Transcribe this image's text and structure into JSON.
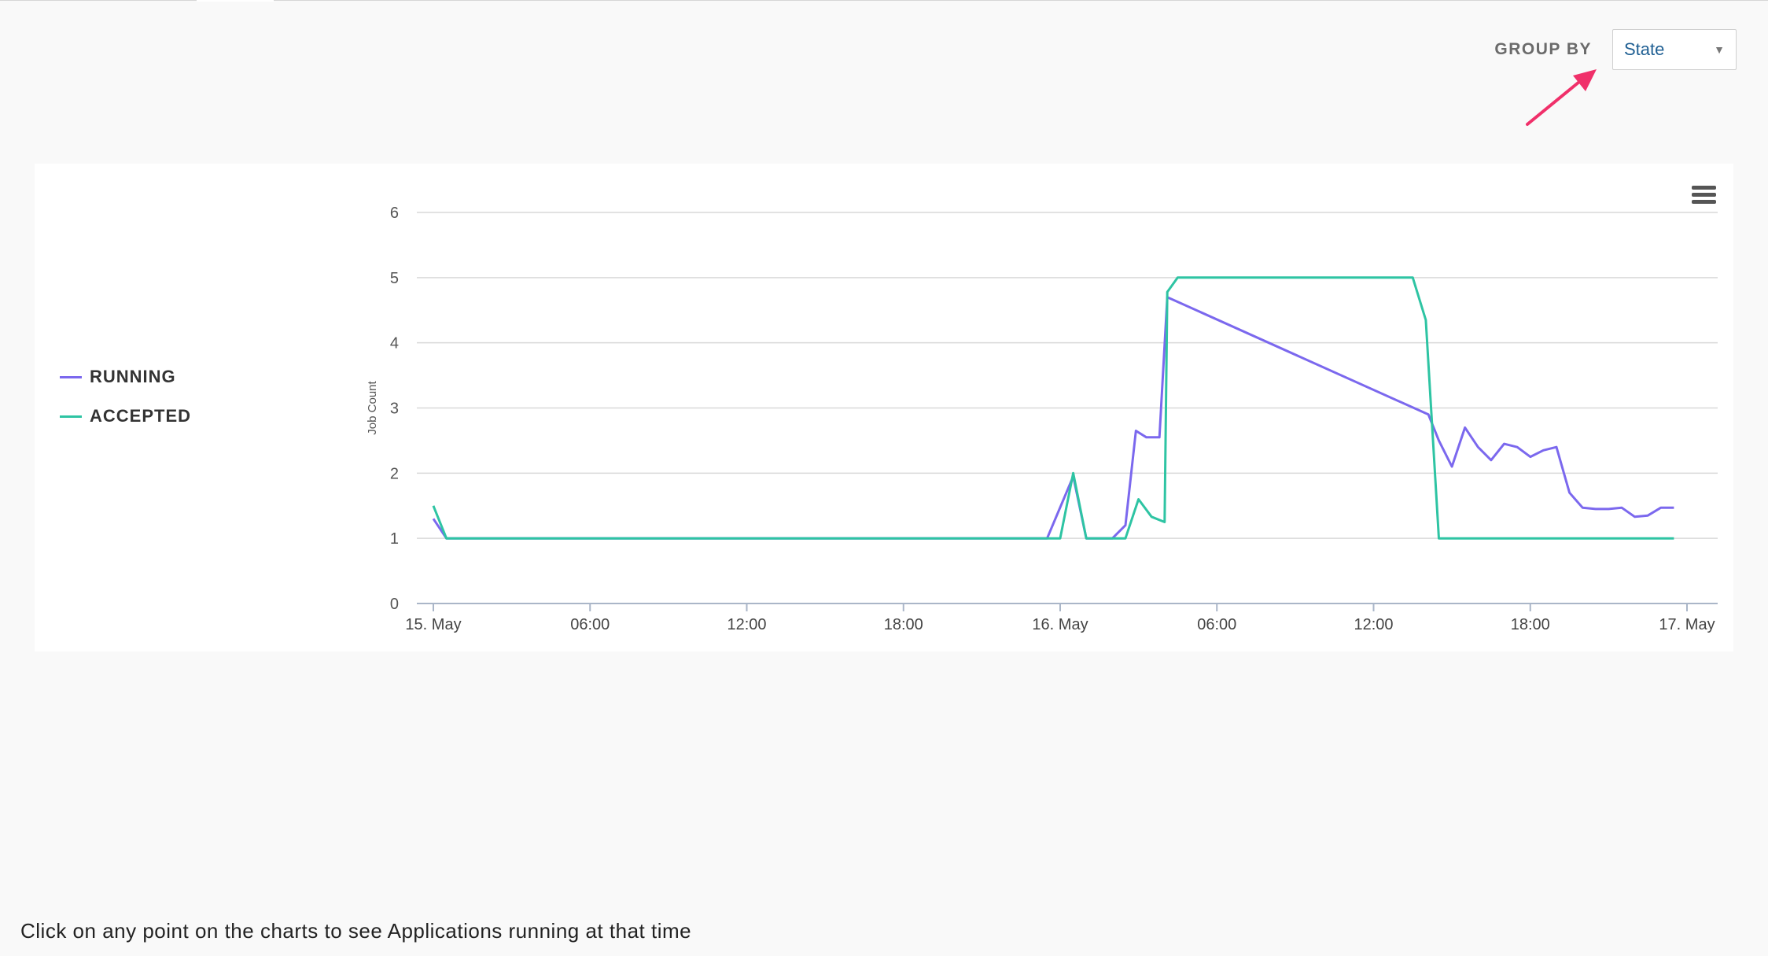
{
  "header": {
    "group_by_label": "GROUP BY",
    "group_by_value": "State"
  },
  "footer": {
    "hint": "Click on any point on the charts to see Applications running at that time"
  },
  "chart_data": {
    "type": "line",
    "ylabel": "Job Count",
    "ylim": [
      0,
      6
    ],
    "yticks": [
      0,
      1,
      2,
      3,
      4,
      5,
      6
    ],
    "xlim_hours": [
      0,
      48
    ],
    "xticks": [
      {
        "t": 0,
        "label": "15. May"
      },
      {
        "t": 6,
        "label": "06:00"
      },
      {
        "t": 12,
        "label": "12:00"
      },
      {
        "t": 18,
        "label": "18:00"
      },
      {
        "t": 24,
        "label": "16. May"
      },
      {
        "t": 30,
        "label": "06:00"
      },
      {
        "t": 36,
        "label": "12:00"
      },
      {
        "t": 42,
        "label": "18:00"
      },
      {
        "t": 48,
        "label": "17. May"
      }
    ],
    "grid": true,
    "legend_position": "left",
    "series": [
      {
        "name": "RUNNING",
        "color": "#7b68ee",
        "points": [
          [
            0,
            1.3
          ],
          [
            0.5,
            1
          ],
          [
            23.5,
            1
          ],
          [
            24.5,
            1.95
          ],
          [
            25,
            1
          ],
          [
            26,
            1
          ],
          [
            26.5,
            1.2
          ],
          [
            26.9,
            2.65
          ],
          [
            27.3,
            2.55
          ],
          [
            27.8,
            2.55
          ],
          [
            28.1,
            4.7
          ],
          [
            38.1,
            2.9
          ],
          [
            38.5,
            2.5
          ],
          [
            39,
            2.1
          ],
          [
            39.5,
            2.7
          ],
          [
            40,
            2.4
          ],
          [
            40.5,
            2.2
          ],
          [
            41,
            2.45
          ],
          [
            41.5,
            2.4
          ],
          [
            42,
            2.25
          ],
          [
            42.5,
            2.35
          ],
          [
            43,
            2.4
          ],
          [
            43.5,
            1.7
          ],
          [
            44,
            1.47
          ],
          [
            44.5,
            1.45
          ],
          [
            45,
            1.45
          ],
          [
            45.5,
            1.47
          ],
          [
            46,
            1.33
          ],
          [
            46.5,
            1.35
          ],
          [
            47,
            1.47
          ],
          [
            47.5,
            1.47
          ]
        ]
      },
      {
        "name": "ACCEPTED",
        "color": "#2ec4a3",
        "points": [
          [
            0,
            1.5
          ],
          [
            0.5,
            1
          ],
          [
            24,
            1
          ],
          [
            24.5,
            2
          ],
          [
            25,
            1
          ],
          [
            26.5,
            1
          ],
          [
            27,
            1.6
          ],
          [
            27.5,
            1.33
          ],
          [
            28,
            1.25
          ],
          [
            28.1,
            4.78
          ],
          [
            28.5,
            5
          ],
          [
            37.5,
            5
          ],
          [
            38,
            4.35
          ],
          [
            38.5,
            1
          ],
          [
            47.5,
            1
          ]
        ]
      }
    ]
  }
}
